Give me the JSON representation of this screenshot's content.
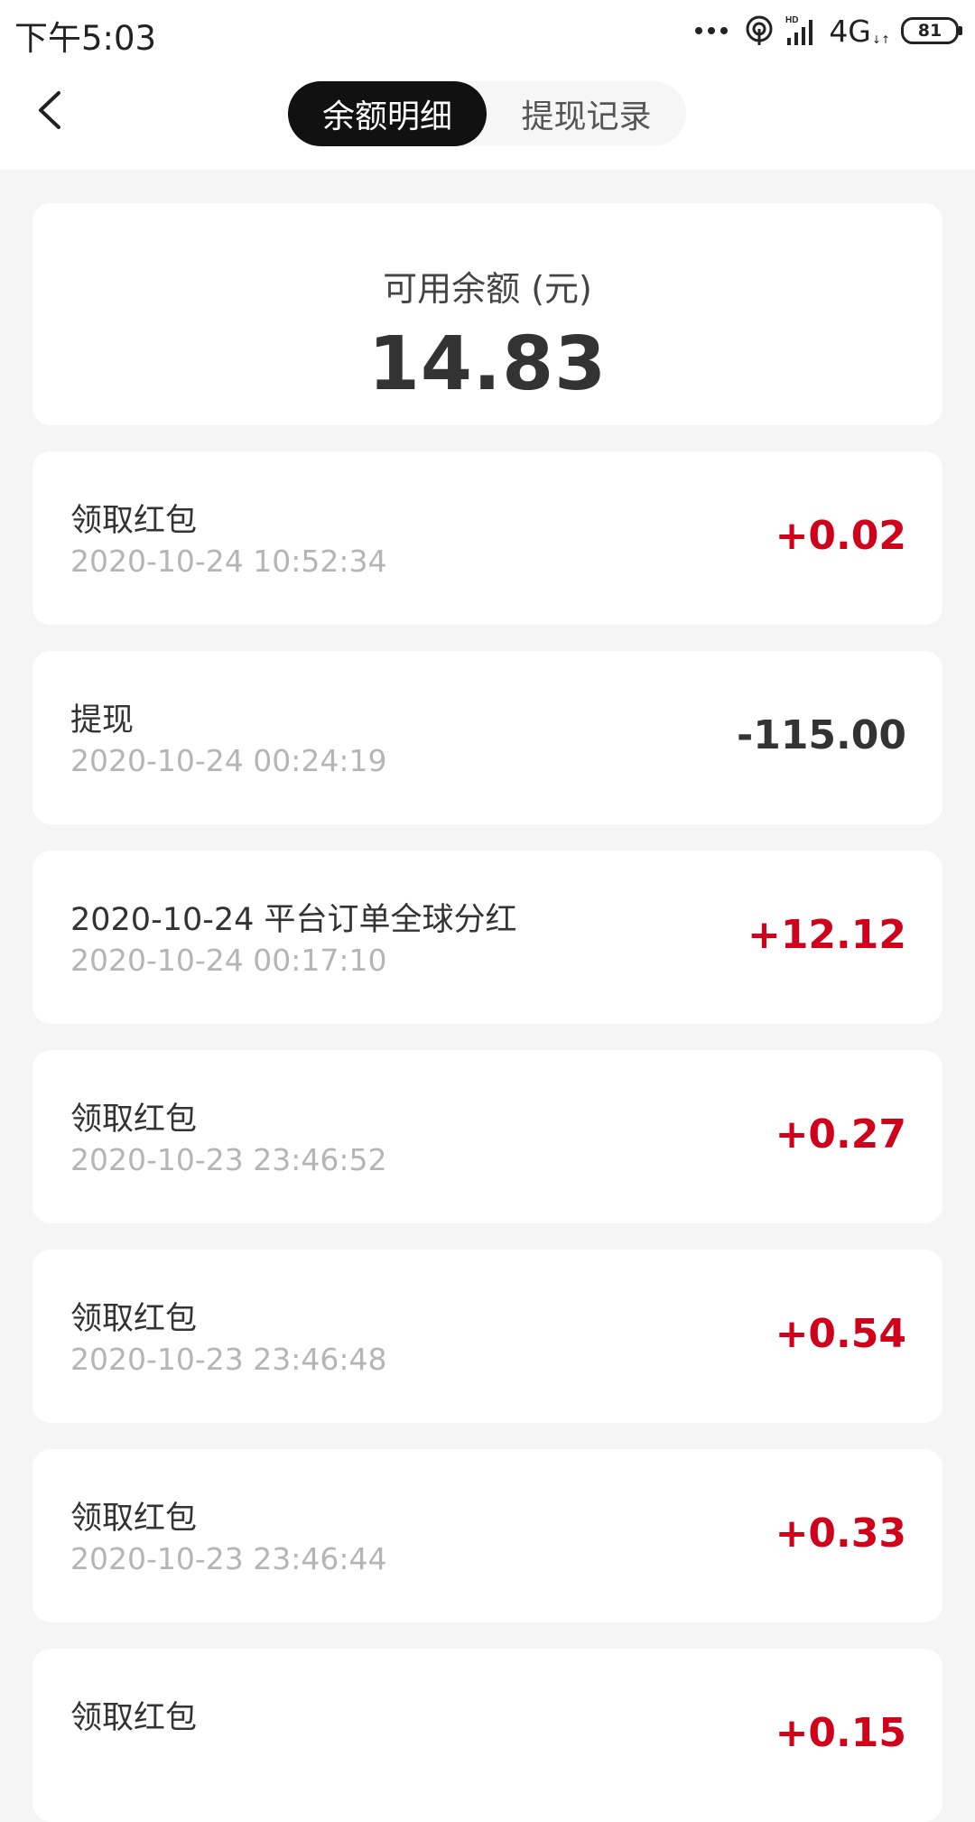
{
  "status_bar": {
    "time": "下午5:03",
    "network": "4G",
    "battery": "81"
  },
  "header": {
    "tabs": [
      {
        "label": "余额明细",
        "active": true
      },
      {
        "label": "提现记录",
        "active": false
      }
    ]
  },
  "balance": {
    "label": "可用余额 (元)",
    "value": "14.83"
  },
  "transactions": [
    {
      "title": "领取红包",
      "time": "2020-10-24 10:52:34",
      "amount": "+0.02"
    },
    {
      "title": "提现",
      "time": "2020-10-24 00:24:19",
      "amount": "-115.00"
    },
    {
      "title": "2020-10-24 平台订单全球分红",
      "time": "2020-10-24 00:17:10",
      "amount": "+12.12"
    },
    {
      "title": "领取红包",
      "time": "2020-10-23 23:46:52",
      "amount": "+0.27"
    },
    {
      "title": "领取红包",
      "time": "2020-10-23 23:46:48",
      "amount": "+0.54"
    },
    {
      "title": "领取红包",
      "time": "2020-10-23 23:46:44",
      "amount": "+0.33"
    },
    {
      "title": "领取红包",
      "time": "",
      "amount": "+0.15"
    }
  ],
  "colors": {
    "positive": "#d0021b",
    "negative": "#333333",
    "active_tab_bg": "#111111"
  },
  "icons": [
    "back-arrow-icon",
    "more-dots-icon",
    "hotspot-icon",
    "signal-icon",
    "battery-icon"
  ]
}
